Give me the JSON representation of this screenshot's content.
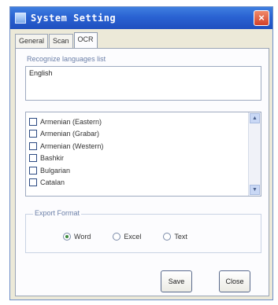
{
  "window": {
    "title": "System Setting",
    "close_glyph": "×"
  },
  "tabs": [
    {
      "label": "General"
    },
    {
      "label": "Scan"
    },
    {
      "label": "OCR",
      "active": true
    }
  ],
  "recognize": {
    "legend": "Recognize languages list",
    "value": "English"
  },
  "languages": [
    {
      "label": "Armenian (Eastern)",
      "checked": false
    },
    {
      "label": "Armenian (Grabar)",
      "checked": false
    },
    {
      "label": "Armenian (Western)",
      "checked": false
    },
    {
      "label": "Bashkir",
      "checked": false
    },
    {
      "label": "Bulgarian",
      "checked": false
    },
    {
      "label": "Catalan",
      "checked": false
    }
  ],
  "export": {
    "legend": "Export Format",
    "options": [
      {
        "label": "Word",
        "selected": true
      },
      {
        "label": "Excel",
        "selected": false
      },
      {
        "label": "Text",
        "selected": false
      }
    ]
  },
  "buttons": {
    "save": "Save",
    "close": "Close"
  },
  "colors": {
    "titlebar": "#2a62d2",
    "dialog": "#ece9d8",
    "panel": "#fcfcfe"
  }
}
